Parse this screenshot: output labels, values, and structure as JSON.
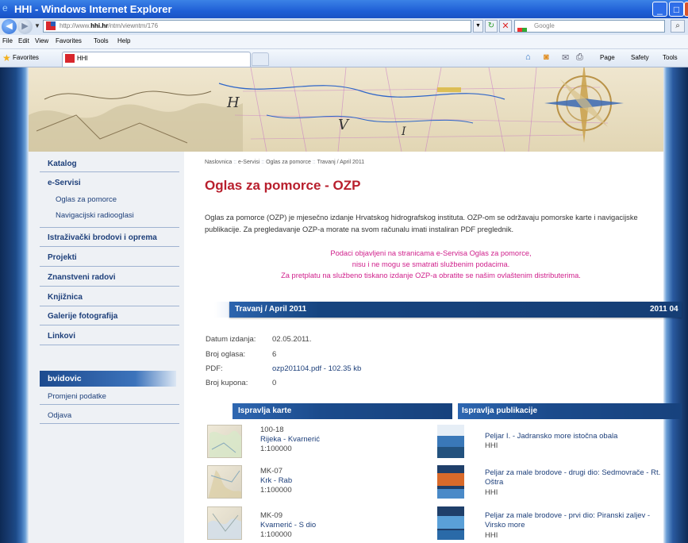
{
  "window": {
    "title": "HHI - Windows Internet Explorer"
  },
  "browser": {
    "url_prefix": "http://www.",
    "url_domain": "hhi.hr",
    "url_path": "/ntm/viewntm/176",
    "search_placeholder": "Google",
    "menu": [
      "File",
      "Edit",
      "View",
      "Favorites",
      "Tools",
      "Help"
    ],
    "favorites_label": "Favorites",
    "tab_title": "HHI",
    "commands": [
      "Page",
      "Safety",
      "Tools"
    ]
  },
  "sidebar": {
    "items": [
      {
        "label": "Katalog"
      },
      {
        "label": "e-Servisi"
      },
      {
        "label": "Istraživački brodovi i oprema"
      },
      {
        "label": "Projekti"
      },
      {
        "label": "Znanstveni radovi"
      },
      {
        "label": "Knjižnica"
      },
      {
        "label": "Galerije fotografija"
      },
      {
        "label": "Linkovi"
      }
    ],
    "subitems": [
      {
        "label": "Oglas za pomorce"
      },
      {
        "label": "Navigacijski radiooglasi"
      }
    ],
    "user": {
      "name": "bvidovic",
      "items": [
        "Promjeni podatke",
        "Odjava"
      ]
    }
  },
  "breadcrumb": [
    "Naslovnica",
    "e-Servisi",
    "Oglas za pomorce",
    "Travanj / April 2011"
  ],
  "breadcrumb_sep": "::",
  "main": {
    "title": "Oglas za pomorce - OZP",
    "intro": "Oglas za pomorce (OZP) je mjesečno izdanje Hrvatskog hidrografskog instituta. OZP-om se održavaju pomorske karte i navigacijske publikacije. Za pregledavanje OZP-a morate na svom računalu imati instaliran PDF preglednik.",
    "notice": [
      "Podaci objavljeni na stranicama e-Servisa Oglas za pomorce,",
      "nisu i ne mogu se smatrati službenim podacima.",
      "Za pretplatu na službeno tiskano izdanje OZP-a obratite se našim ovlaštenim distributerima."
    ],
    "section": {
      "title": "Travanj / April 2011",
      "code": "2011 04"
    },
    "meta": {
      "date_label": "Datum izdanja:",
      "date_value": "02.05.2011.",
      "count_label": "Broj oglasa:",
      "count_value": "6",
      "pdf_label": "PDF:",
      "pdf_value": "ozp201104.pdf - 102.35 kb",
      "coupon_label": "Broj kupona:",
      "coupon_value": "0"
    },
    "charts_title": "Ispravlja karte",
    "publications_title": "Ispravlja publikacije",
    "charts": [
      {
        "code": "100-18",
        "name": "Rijeka - Kvarnerić",
        "scale": "1:100000"
      },
      {
        "code": "MK-07",
        "name": "Krk - Rab",
        "scale": "1:100000"
      },
      {
        "code": "MK-09",
        "name": "Kvarnerić - S dio",
        "scale": "1:100000"
      }
    ],
    "publications": [
      {
        "name": "Peljar I. - Jadransko more istočna obala",
        "publisher": "HHI"
      },
      {
        "name": "Peljar za male brodove - drugi dio: Sedmovrače - Rt. Oštra",
        "publisher": "HHI"
      },
      {
        "name": "Peljar za male brodove - prvi dio: Piranski zaljev - Virsko more",
        "publisher": "HHI"
      }
    ]
  },
  "colors": {
    "accent_red": "#b81f2d",
    "notice_magenta": "#d0218c",
    "nav_blue": "#1d3f7a",
    "bar_blue": "#1b4b8c"
  }
}
